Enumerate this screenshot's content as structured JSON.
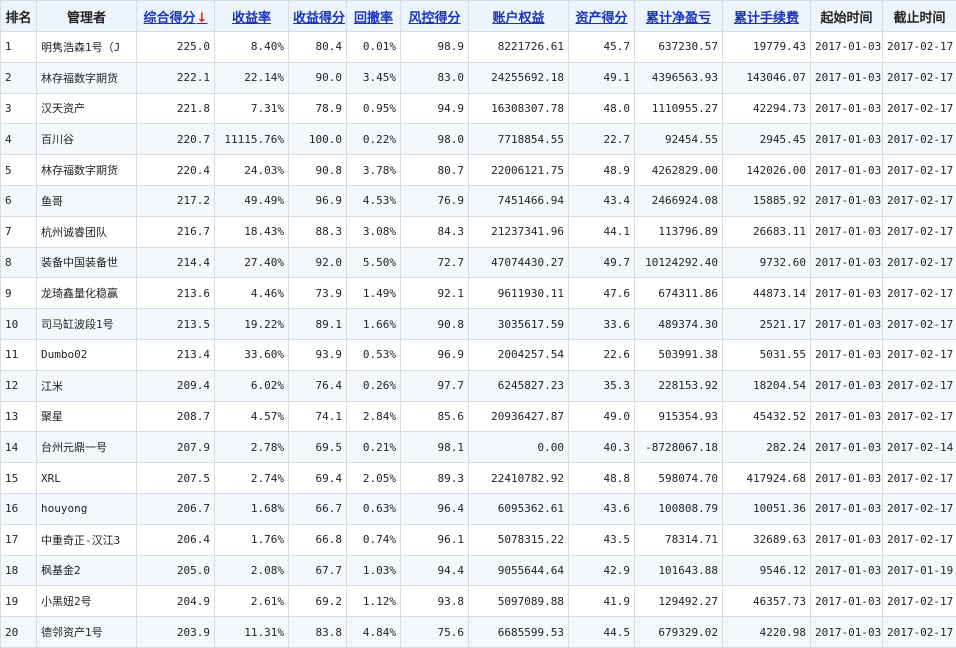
{
  "colors": {
    "positive": "#d0202a",
    "negative": "#4c8a14",
    "link": "#1a35b8",
    "header_bg": "#eef4fb"
  },
  "sort": {
    "column": "综合得分",
    "direction": "desc",
    "icon": "arrow-down-icon",
    "glyph": "↓"
  },
  "headers": [
    "排名",
    "管理者",
    "综合得分",
    "收益率",
    "收益得分",
    "回撤率",
    "风控得分",
    "账户权益",
    "资产得分",
    "累计净盈亏",
    "累计手续费",
    "起始时间",
    "截止时间"
  ],
  "rows": [
    {
      "rank": "1",
      "name": "明隽浩森1号（J",
      "score": "225.0",
      "yield": "8.40%",
      "yield_score": "80.4",
      "drawdown": "0.01%",
      "risk_score": "98.9",
      "equity": "8221726.61",
      "asset_score": "45.7",
      "net_profit": "637230.57",
      "fees": "19779.43",
      "start": "2017-01-03",
      "end": "2017-02-17"
    },
    {
      "rank": "2",
      "name": "林存福数字期货",
      "score": "222.1",
      "yield": "22.14%",
      "yield_score": "90.0",
      "drawdown": "3.45%",
      "risk_score": "83.0",
      "equity": "24255692.18",
      "asset_score": "49.1",
      "net_profit": "4396563.93",
      "fees": "143046.07",
      "start": "2017-01-03",
      "end": "2017-02-17"
    },
    {
      "rank": "3",
      "name": "汉天资产",
      "score": "221.8",
      "yield": "7.31%",
      "yield_score": "78.9",
      "drawdown": "0.95%",
      "risk_score": "94.9",
      "equity": "16308307.78",
      "asset_score": "48.0",
      "net_profit": "1110955.27",
      "fees": "42294.73",
      "start": "2017-01-03",
      "end": "2017-02-17"
    },
    {
      "rank": "4",
      "name": "百川谷",
      "score": "220.7",
      "yield": "11115.76%",
      "yield_score": "100.0",
      "drawdown": "0.22%",
      "risk_score": "98.0",
      "equity": "7718854.55",
      "asset_score": "22.7",
      "net_profit": "92454.55",
      "fees": "2945.45",
      "start": "2017-01-03",
      "end": "2017-02-17"
    },
    {
      "rank": "5",
      "name": "林存福数字期货",
      "score": "220.4",
      "yield": "24.03%",
      "yield_score": "90.8",
      "drawdown": "3.78%",
      "risk_score": "80.7",
      "equity": "22006121.75",
      "asset_score": "48.9",
      "net_profit": "4262829.00",
      "fees": "142026.00",
      "start": "2017-01-03",
      "end": "2017-02-17"
    },
    {
      "rank": "6",
      "name": "鱼哥",
      "score": "217.2",
      "yield": "49.49%",
      "yield_score": "96.9",
      "drawdown": "4.53%",
      "risk_score": "76.9",
      "equity": "7451466.94",
      "asset_score": "43.4",
      "net_profit": "2466924.08",
      "fees": "15885.92",
      "start": "2017-01-03",
      "end": "2017-02-17"
    },
    {
      "rank": "7",
      "name": "杭州诚睿团队",
      "score": "216.7",
      "yield": "18.43%",
      "yield_score": "88.3",
      "drawdown": "3.08%",
      "risk_score": "84.3",
      "equity": "21237341.96",
      "asset_score": "44.1",
      "net_profit": "113796.89",
      "fees": "26683.11",
      "start": "2017-01-03",
      "end": "2017-02-17"
    },
    {
      "rank": "8",
      "name": "装备中国装备世",
      "score": "214.4",
      "yield": "27.40%",
      "yield_score": "92.0",
      "drawdown": "5.50%",
      "risk_score": "72.7",
      "equity": "47074430.27",
      "asset_score": "49.7",
      "net_profit": "10124292.40",
      "fees": "9732.60",
      "start": "2017-01-03",
      "end": "2017-02-17"
    },
    {
      "rank": "9",
      "name": "龙琦鑫量化稳赢",
      "score": "213.6",
      "yield": "4.46%",
      "yield_score": "73.9",
      "drawdown": "1.49%",
      "risk_score": "92.1",
      "equity": "9611930.11",
      "asset_score": "47.6",
      "net_profit": "674311.86",
      "fees": "44873.14",
      "start": "2017-01-03",
      "end": "2017-02-17"
    },
    {
      "rank": "10",
      "name": "司马缸波段1号",
      "score": "213.5",
      "yield": "19.22%",
      "yield_score": "89.1",
      "drawdown": "1.66%",
      "risk_score": "90.8",
      "equity": "3035617.59",
      "asset_score": "33.6",
      "net_profit": "489374.30",
      "fees": "2521.17",
      "start": "2017-01-03",
      "end": "2017-02-17"
    },
    {
      "rank": "11",
      "name": "Dumbo02",
      "score": "213.4",
      "yield": "33.60%",
      "yield_score": "93.9",
      "drawdown": "0.53%",
      "risk_score": "96.9",
      "equity": "2004257.54",
      "asset_score": "22.6",
      "net_profit": "503991.38",
      "fees": "5031.55",
      "start": "2017-01-03",
      "end": "2017-02-17"
    },
    {
      "rank": "12",
      "name": "江米",
      "score": "209.4",
      "yield": "6.02%",
      "yield_score": "76.4",
      "drawdown": "0.26%",
      "risk_score": "97.7",
      "equity": "6245827.23",
      "asset_score": "35.3",
      "net_profit": "228153.92",
      "fees": "18204.54",
      "start": "2017-01-03",
      "end": "2017-02-17"
    },
    {
      "rank": "13",
      "name": "聚星",
      "score": "208.7",
      "yield": "4.57%",
      "yield_score": "74.1",
      "drawdown": "2.84%",
      "risk_score": "85.6",
      "equity": "20936427.87",
      "asset_score": "49.0",
      "net_profit": "915354.93",
      "fees": "45432.52",
      "start": "2017-01-03",
      "end": "2017-02-17"
    },
    {
      "rank": "14",
      "name": "台州元鼎一号",
      "score": "207.9",
      "yield": "2.78%",
      "yield_score": "69.5",
      "drawdown": "0.21%",
      "risk_score": "98.1",
      "equity": "0.00",
      "asset_score": "40.3",
      "net_profit": "-8728067.18",
      "fees": "282.24",
      "start": "2017-01-03",
      "end": "2017-02-14"
    },
    {
      "rank": "15",
      "name": "XRL",
      "score": "207.5",
      "yield": "2.74%",
      "yield_score": "69.4",
      "drawdown": "2.05%",
      "risk_score": "89.3",
      "equity": "22410782.92",
      "asset_score": "48.8",
      "net_profit": "598074.70",
      "fees": "417924.68",
      "start": "2017-01-03",
      "end": "2017-02-17"
    },
    {
      "rank": "16",
      "name": "houyong",
      "score": "206.7",
      "yield": "1.68%",
      "yield_score": "66.7",
      "drawdown": "0.63%",
      "risk_score": "96.4",
      "equity": "6095362.61",
      "asset_score": "43.6",
      "net_profit": "100808.79",
      "fees": "10051.36",
      "start": "2017-01-03",
      "end": "2017-02-17"
    },
    {
      "rank": "17",
      "name": "中重奇正-汉江3",
      "score": "206.4",
      "yield": "1.76%",
      "yield_score": "66.8",
      "drawdown": "0.74%",
      "risk_score": "96.1",
      "equity": "5078315.22",
      "asset_score": "43.5",
      "net_profit": "78314.71",
      "fees": "32689.63",
      "start": "2017-01-03",
      "end": "2017-02-17"
    },
    {
      "rank": "18",
      "name": "枫基金2",
      "score": "205.0",
      "yield": "2.08%",
      "yield_score": "67.7",
      "drawdown": "1.03%",
      "risk_score": "94.4",
      "equity": "9055644.64",
      "asset_score": "42.9",
      "net_profit": "101643.88",
      "fees": "9546.12",
      "start": "2017-01-03",
      "end": "2017-01-19"
    },
    {
      "rank": "19",
      "name": "小黑妞2号",
      "score": "204.9",
      "yield": "2.61%",
      "yield_score": "69.2",
      "drawdown": "1.12%",
      "risk_score": "93.8",
      "equity": "5097089.88",
      "asset_score": "41.9",
      "net_profit": "129492.27",
      "fees": "46357.73",
      "start": "2017-01-03",
      "end": "2017-02-17"
    },
    {
      "rank": "20",
      "name": "德邻资产1号",
      "score": "203.9",
      "yield": "11.31%",
      "yield_score": "83.8",
      "drawdown": "4.84%",
      "risk_score": "75.6",
      "equity": "6685599.53",
      "asset_score": "44.5",
      "net_profit": "679329.02",
      "fees": "4220.98",
      "start": "2017-01-03",
      "end": "2017-02-17"
    }
  ]
}
